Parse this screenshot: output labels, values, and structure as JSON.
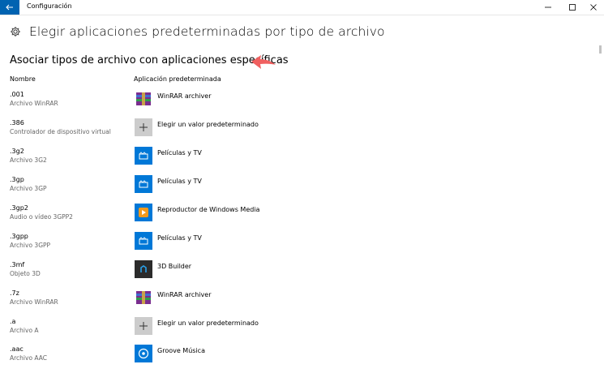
{
  "window": {
    "title": "Configuración"
  },
  "page": {
    "title": "Elegir aplicaciones predeterminadas por tipo de archivo",
    "section_title": "Asociar tipos de archivo con aplicaciones específicas",
    "col_name": "Nombre",
    "col_app": "Aplicación predeterminada"
  },
  "rows": [
    {
      "ext": ".001",
      "desc": "Archivo WinRAR",
      "app": "WinRAR archiver",
      "icon": "winrar-icon"
    },
    {
      "ext": ".386",
      "desc": "Controlador de dispositivo virtual",
      "app": "Elegir un valor predeterminado",
      "icon": "plus-icon"
    },
    {
      "ext": ".3g2",
      "desc": "Archivo 3G2",
      "app": "Películas y TV",
      "icon": "movies-tv-icon"
    },
    {
      "ext": ".3gp",
      "desc": "Archivo 3GP",
      "app": "Películas y TV",
      "icon": "movies-tv-icon"
    },
    {
      "ext": ".3gp2",
      "desc": "Audio o vídeo 3GPP2",
      "app": "Reproductor de Windows Media",
      "icon": "windows-media-player-icon"
    },
    {
      "ext": ".3gpp",
      "desc": "Archivo 3GPP",
      "app": "Películas y TV",
      "icon": "movies-tv-icon"
    },
    {
      "ext": ".3mf",
      "desc": "Objeto 3D",
      "app": "3D Builder",
      "icon": "3d-builder-icon"
    },
    {
      "ext": ".7z",
      "desc": "Archivo WinRAR",
      "app": "WinRAR archiver",
      "icon": "winrar-icon"
    },
    {
      "ext": ".a",
      "desc": "Archivo A",
      "app": "Elegir un valor predeterminado",
      "icon": "plus-icon"
    },
    {
      "ext": ".aac",
      "desc": "Archivo AAC",
      "app": "Groove Música",
      "icon": "groove-music-icon"
    }
  ],
  "colors": {
    "accent": "#0078d7",
    "back_button": "#0063b1",
    "annotation_arrow": "#f06060"
  }
}
